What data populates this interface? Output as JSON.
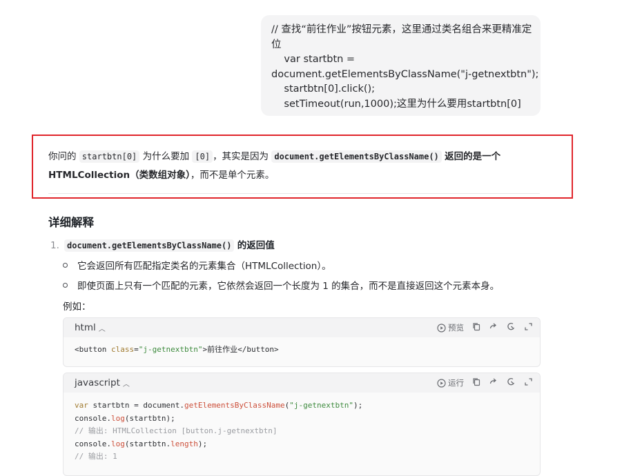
{
  "user_message": {
    "lines": [
      "// 查找“前往作业”按钮元素，这里通过类名组合来更精准定",
      "位",
      "    var startbtn =",
      "document.getElementsByClassName(\"j-getnextbtn\");",
      "    startbtn[0].click();",
      "    setTimeout(run,1000);这里为什么要用startbtn[0]"
    ]
  },
  "answer": {
    "intro": {
      "t1": "你问的",
      "c1": "startbtn[0]",
      "t2": "为什么要加",
      "c2": "[0]",
      "t3": "，其实是因为",
      "c3": "document.getElementsByClassName()",
      "b1": "返回的是一个",
      "b2": "HTMLCollection（类数组对象）",
      "t4": "，而不是单个元素。"
    },
    "section_title": "详细解释",
    "list_item_1": {
      "number": "1.",
      "code": "document.getElementsByClassName()",
      "text": "的返回值"
    },
    "bullets": [
      "它会返回所有匹配指定类名的元素集合（HTMLCollection）。",
      "即使页面上只有一个匹配的元素，它依然会返回一个长度为 1 的集合，而不是直接返回这个元素本身。"
    ],
    "example_label": "例如："
  },
  "code_blocks": [
    {
      "lang": "html",
      "action_label": "预览",
      "tokens": {
        "a": "<button ",
        "b": "class",
        "c": "=",
        "d": "\"j-getnextbtn\"",
        "e": ">前往作业</button>"
      }
    },
    {
      "lang": "javascript",
      "action_label": "运行",
      "l1": {
        "a": "var",
        "b": " startbtn = document.",
        "c": "getElementsByClassName",
        "d": "(",
        "e": "\"j-getnextbtn\"",
        "f": ");"
      },
      "l2": {
        "a": "console.",
        "b": "log",
        "c": "(startbtn);"
      },
      "l3": "// 输出: HTMLCollection [button.j-getnextbtn]",
      "l4": {
        "a": "console.",
        "b": "log",
        "c": "(startbtn.",
        "d": "length",
        "e": ");"
      },
      "l5": "// 输出: 1"
    }
  ],
  "icons": {
    "play": "play-circle-icon",
    "copy": "copy-icon",
    "share": "share-arrow-icon",
    "wrap": "line-wrap-icon",
    "expand": "expand-icon"
  }
}
